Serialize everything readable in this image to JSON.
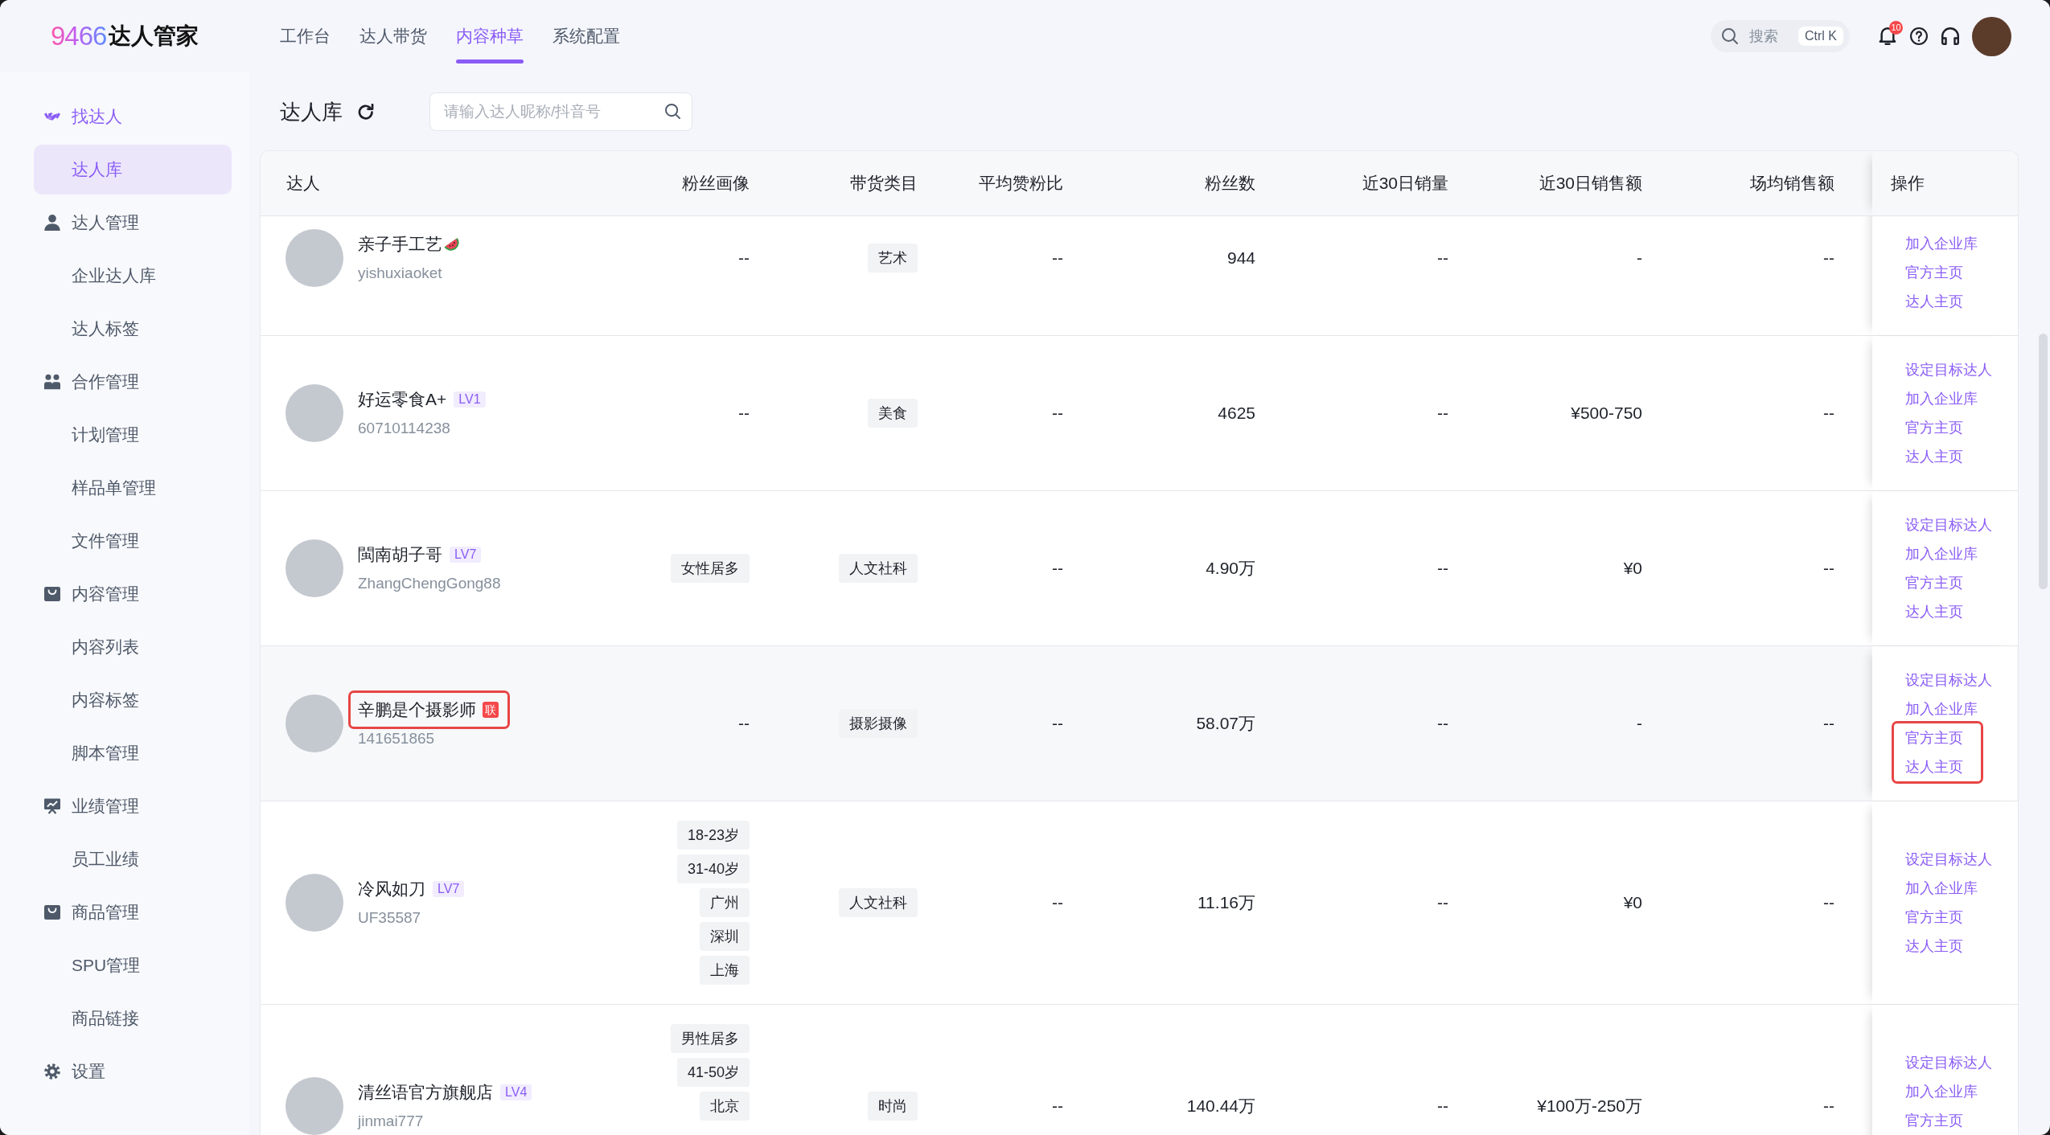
{
  "logo": {
    "mark": "9466",
    "text": "达人管家"
  },
  "nav": [
    {
      "label": "工作台",
      "selected": false
    },
    {
      "label": "达人带货",
      "selected": false
    },
    {
      "label": "内容种草",
      "selected": true
    },
    {
      "label": "系统配置",
      "selected": false
    }
  ],
  "header_search": {
    "label": "搜索",
    "shortcut": "Ctrl K"
  },
  "notifications": {
    "count": "10"
  },
  "sidebar": {
    "items": [
      {
        "label": "找达人",
        "kind": "find",
        "active": true,
        "children": [
          {
            "label": "达人库",
            "selected": true
          }
        ]
      },
      {
        "label": "达人管理",
        "kind": "talent",
        "active": false,
        "children": [
          {
            "label": "企业达人库",
            "selected": false
          },
          {
            "label": "达人标签",
            "selected": false
          }
        ]
      },
      {
        "label": "合作管理",
        "kind": "cooperation",
        "active": false,
        "children": [
          {
            "label": "计划管理",
            "selected": false
          },
          {
            "label": "样品单管理",
            "selected": false
          },
          {
            "label": "文件管理",
            "selected": false
          }
        ]
      },
      {
        "label": "内容管理",
        "kind": "content",
        "active": false,
        "children": [
          {
            "label": "内容列表",
            "selected": false
          },
          {
            "label": "内容标签",
            "selected": false
          },
          {
            "label": "脚本管理",
            "selected": false
          }
        ]
      },
      {
        "label": "业绩管理",
        "kind": "performance",
        "active": false,
        "children": [
          {
            "label": "员工业绩",
            "selected": false
          }
        ]
      },
      {
        "label": "商品管理",
        "kind": "product",
        "active": false,
        "children": [
          {
            "label": "SPU管理",
            "selected": false
          },
          {
            "label": "商品链接",
            "selected": false
          }
        ]
      },
      {
        "label": "设置",
        "kind": "settings",
        "active": false
      }
    ]
  },
  "page": {
    "title": "达人库",
    "search": {
      "placeholder": "请输入达人昵称/抖音号"
    }
  },
  "table": {
    "columns": [
      "达人",
      "粉丝画像",
      "带货类目",
      "平均赞粉比",
      "粉丝数",
      "近30日销量",
      "近30日销售额",
      "场均销售额",
      "操作"
    ],
    "rows": [
      {
        "name": "亲子手工艺",
        "emoji": true,
        "handle": "yishuxiaoket",
        "fan_portrait": "--",
        "category": "艺术",
        "like_ratio": "--",
        "fans": "944",
        "sales_30d": "--",
        "revenue_30d": "-",
        "avg_revenue": "--",
        "highlighted": false,
        "name_boxed": false,
        "actions": [
          {
            "label": "加入企业库",
            "boxed": false
          },
          {
            "label": "官方主页",
            "boxed": false
          },
          {
            "label": "达人主页",
            "boxed": false
          }
        ]
      },
      {
        "name": "好运零食A+",
        "emoji": false,
        "badge": {
          "kind": "level",
          "text": "LV1"
        },
        "handle": "60710114238",
        "fan_portrait": "--",
        "category": "美食",
        "like_ratio": "--",
        "fans": "4625",
        "sales_30d": "--",
        "revenue_30d": "¥500-750",
        "avg_revenue": "--",
        "highlighted": false,
        "name_boxed": false,
        "actions": [
          {
            "label": "设定目标达人",
            "boxed": false
          },
          {
            "label": "加入企业库",
            "boxed": false
          },
          {
            "label": "官方主页",
            "boxed": false
          },
          {
            "label": "达人主页",
            "boxed": false
          }
        ]
      },
      {
        "name": "閩南胡子哥",
        "emoji": false,
        "badge": {
          "kind": "level",
          "text": "LV7"
        },
        "handle": "ZhangChengGong88",
        "fan_portrait": [
          "女性居多"
        ],
        "category": "人文社科",
        "like_ratio": "--",
        "fans": "4.90万",
        "sales_30d": "--",
        "revenue_30d": "¥0",
        "avg_revenue": "--",
        "highlighted": false,
        "name_boxed": false,
        "actions": [
          {
            "label": "设定目标达人",
            "boxed": false
          },
          {
            "label": "加入企业库",
            "boxed": false
          },
          {
            "label": "官方主页",
            "boxed": false
          },
          {
            "label": "达人主页",
            "boxed": false
          }
        ]
      },
      {
        "name": "辛鹏是个摄影师",
        "emoji": false,
        "badge": {
          "kind": "alliance",
          "text": "联"
        },
        "handle": "141651865",
        "fan_portrait": "--",
        "category": "摄影摄像",
        "like_ratio": "--",
        "fans": "58.07万",
        "sales_30d": "--",
        "revenue_30d": "-",
        "avg_revenue": "--",
        "highlighted": true,
        "name_boxed": true,
        "actions": [
          {
            "label": "设定目标达人",
            "boxed": false
          },
          {
            "label": "加入企业库",
            "boxed": false
          },
          {
            "label": "官方主页",
            "boxed": true
          },
          {
            "label": "达人主页",
            "boxed": true
          }
        ]
      },
      {
        "name": "冷风如刀",
        "emoji": false,
        "badge": {
          "kind": "level",
          "text": "LV7"
        },
        "handle": "UF35587",
        "fan_portrait": [
          "18-23岁",
          "31-40岁",
          "广州",
          "深圳",
          "上海"
        ],
        "category": "人文社科",
        "like_ratio": "--",
        "fans": "11.16万",
        "sales_30d": "--",
        "revenue_30d": "¥0",
        "avg_revenue": "--",
        "highlighted": false,
        "name_boxed": false,
        "actions": [
          {
            "label": "设定目标达人",
            "boxed": false
          },
          {
            "label": "加入企业库",
            "boxed": false
          },
          {
            "label": "官方主页",
            "boxed": false
          },
          {
            "label": "达人主页",
            "boxed": false
          }
        ]
      },
      {
        "name": "清丝语官方旗舰店",
        "emoji": false,
        "badge": {
          "kind": "level",
          "text": "LV4"
        },
        "handle": "jinmai777",
        "fan_portrait": [
          "男性居多",
          "41-50岁",
          "北京"
        ],
        "category": "时尚",
        "like_ratio": "--",
        "fans": "140.44万",
        "sales_30d": "--",
        "revenue_30d": "¥100万-250万",
        "avg_revenue": "--",
        "highlighted": false,
        "name_boxed": false,
        "actions": [
          {
            "label": "设定目标达人",
            "boxed": false
          },
          {
            "label": "加入企业库",
            "boxed": false
          },
          {
            "label": "官方主页",
            "boxed": false
          }
        ]
      }
    ]
  }
}
